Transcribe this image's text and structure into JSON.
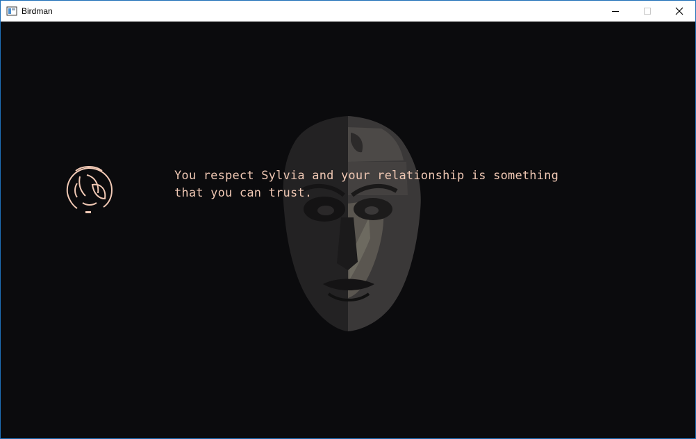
{
  "window": {
    "title": "Birdman",
    "controls": {
      "minimize_icon": "minimize-icon",
      "maximize_icon": "maximize-icon",
      "close_icon": "close-icon"
    }
  },
  "game": {
    "background_color": "#0b0b0d",
    "text_color": "#f0c8b4",
    "dialogue": {
      "line1": "You respect Sylvia and your relationship is something",
      "line2": "that you can trust."
    },
    "portrait_icon": "character-portrait",
    "background_art": "mask-face-art"
  }
}
